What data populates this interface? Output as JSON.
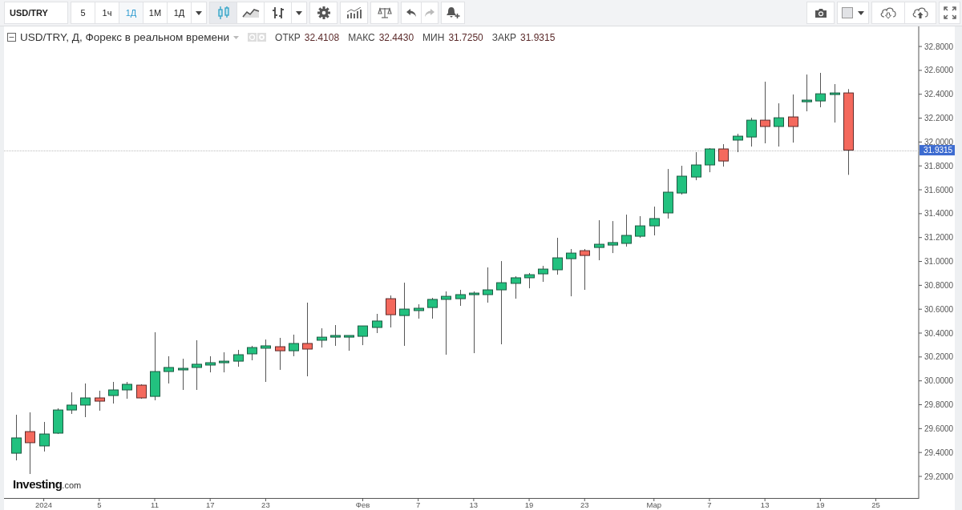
{
  "toolbar": {
    "symbol": "USD/TRY",
    "intervals": [
      {
        "label": "5",
        "selected": false
      },
      {
        "label": "1ч",
        "selected": false
      },
      {
        "label": "1Д",
        "selected": true
      },
      {
        "label": "1М",
        "selected": false
      },
      {
        "label": "1Д",
        "selected": false
      }
    ],
    "chart_styles": [
      {
        "kind": "candles",
        "selected": true
      },
      {
        "kind": "line",
        "selected": false
      },
      {
        "kind": "bars",
        "selected": false
      }
    ],
    "undo": {
      "disabled": false
    },
    "redo": {
      "disabled": true
    }
  },
  "legend": {
    "title": "USD/TRY, Д, Форекс в реальном времени",
    "stats": [
      {
        "label": "ОТКР",
        "value": "32.4108"
      },
      {
        "label": "МАКС",
        "value": "32.4430"
      },
      {
        "label": "МИН",
        "value": "31.7250"
      },
      {
        "label": "ЗАКР",
        "value": "31.9315"
      }
    ]
  },
  "chart": {
    "logo": {
      "brand": "Investing",
      "suffix": ".com"
    },
    "chart_data": {
      "type": "candlestick",
      "categories": [
        null,
        null,
        "2024",
        null,
        null,
        null,
        "5",
        null,
        null,
        null,
        "11",
        null,
        null,
        null,
        "17",
        null,
        null,
        null,
        "23",
        null,
        null,
        null,
        null,
        null,
        null,
        "Фев",
        null,
        null,
        null,
        "7",
        null,
        null,
        null,
        "13",
        null,
        null,
        null,
        "19",
        null,
        null,
        null,
        "23",
        null,
        null,
        null,
        null,
        "Мар",
        null,
        null,
        null,
        "7",
        null,
        null,
        null,
        "13",
        null,
        null,
        null,
        "19",
        null,
        null,
        null,
        "25"
      ],
      "ohlc": [
        [
          29.394,
          29.716,
          29.334,
          29.522
        ],
        [
          29.575,
          29.736,
          29.22,
          29.482
        ],
        [
          29.455,
          29.656,
          29.408,
          29.555
        ],
        [
          29.562,
          29.77,
          29.555,
          29.756
        ],
        [
          29.756,
          29.904,
          29.723,
          29.797
        ],
        [
          29.797,
          29.978,
          29.696,
          29.857
        ],
        [
          29.857,
          29.917,
          29.75,
          29.83
        ],
        [
          29.877,
          29.991,
          29.81,
          29.924
        ],
        [
          29.924,
          29.991,
          29.85,
          29.971
        ],
        [
          29.964,
          29.971,
          29.85,
          29.857
        ],
        [
          29.87,
          30.407,
          29.837,
          30.078
        ],
        [
          30.078,
          30.206,
          29.978,
          30.112
        ],
        [
          30.092,
          30.185,
          29.924,
          30.105
        ],
        [
          30.112,
          30.34,
          29.924,
          30.139
        ],
        [
          30.132,
          30.206,
          30.071,
          30.152
        ],
        [
          30.152,
          30.239,
          30.071,
          30.165
        ],
        [
          30.165,
          30.259,
          30.118,
          30.219
        ],
        [
          30.226,
          30.293,
          30.172,
          30.279
        ],
        [
          30.273,
          30.346,
          29.991,
          30.293
        ],
        [
          30.286,
          30.36,
          30.092,
          30.252
        ],
        [
          30.252,
          30.387,
          30.206,
          30.313
        ],
        [
          30.313,
          30.655,
          30.038,
          30.266
        ],
        [
          30.34,
          30.44,
          30.279,
          30.366
        ],
        [
          30.366,
          30.467,
          30.293,
          30.38
        ],
        [
          30.366,
          30.38,
          30.252,
          30.38
        ],
        [
          30.373,
          30.46,
          30.299,
          30.46
        ],
        [
          30.447,
          30.561,
          30.4,
          30.501
        ],
        [
          30.688,
          30.715,
          30.447,
          30.554
        ],
        [
          30.547,
          30.822,
          30.293,
          30.601
        ],
        [
          30.588,
          30.641,
          30.521,
          30.608
        ],
        [
          30.614,
          30.695,
          30.521,
          30.682
        ],
        [
          30.682,
          30.749,
          30.219,
          30.708
        ],
        [
          30.688,
          30.762,
          30.628,
          30.722
        ],
        [
          30.722,
          30.749,
          30.232,
          30.735
        ],
        [
          30.722,
          30.95,
          30.655,
          30.762
        ],
        [
          30.762,
          31.003,
          30.306,
          30.822
        ],
        [
          30.816,
          30.876,
          30.688,
          30.863
        ],
        [
          30.863,
          30.903,
          30.775,
          30.889
        ],
        [
          30.896,
          30.963,
          30.829,
          30.936
        ],
        [
          30.93,
          31.198,
          30.889,
          31.03
        ],
        [
          31.023,
          31.104,
          30.708,
          31.07
        ],
        [
          31.09,
          31.104,
          30.762,
          31.05
        ],
        [
          31.117,
          31.345,
          31.01,
          31.144
        ],
        [
          31.137,
          31.338,
          31.07,
          31.158
        ],
        [
          31.151,
          31.392,
          31.124,
          31.218
        ],
        [
          31.211,
          31.379,
          31.198,
          31.298
        ],
        [
          31.298,
          31.459,
          31.218,
          31.359
        ],
        [
          31.406,
          31.774,
          31.359,
          31.58
        ],
        [
          31.573,
          31.801,
          31.56,
          31.714
        ],
        [
          31.707,
          31.915,
          31.68,
          31.808
        ],
        [
          31.808,
          31.949,
          31.747,
          31.942
        ],
        [
          31.942,
          31.982,
          31.794,
          31.841
        ],
        [
          32.016,
          32.069,
          31.915,
          32.049
        ],
        [
          32.042,
          32.203,
          31.962,
          32.183
        ],
        [
          32.183,
          32.505,
          31.989,
          32.13
        ],
        [
          32.13,
          32.324,
          31.962,
          32.203
        ],
        [
          32.21,
          32.398,
          31.995,
          32.13
        ],
        [
          32.337,
          32.565,
          32.257,
          32.351
        ],
        [
          32.344,
          32.579,
          32.291,
          32.404
        ],
        [
          32.404,
          32.485,
          32.163,
          32.411
        ],
        [
          32.411,
          32.443,
          31.725,
          31.932
        ],
        null,
        null
      ],
      "ylim": [
        29.019,
        32.968
      ],
      "yticks": [
        {
          "value": 29.2,
          "label": "29.2000"
        },
        {
          "value": 29.4,
          "label": "29.4000"
        },
        {
          "value": 29.6,
          "label": "29.6000"
        },
        {
          "value": 29.8,
          "label": "29.8000"
        },
        {
          "value": 30.0,
          "label": "30.0000"
        },
        {
          "value": 30.2,
          "label": "30.2000"
        },
        {
          "value": 30.4,
          "label": "30.4000"
        },
        {
          "value": 30.6,
          "label": "30.6000"
        },
        {
          "value": 30.8,
          "label": "30.8000"
        },
        {
          "value": 31.0,
          "label": "31.0000"
        },
        {
          "value": 31.2,
          "label": "31.2000"
        },
        {
          "value": 31.4,
          "label": "31.4000"
        },
        {
          "value": 31.6,
          "label": "31.6000"
        },
        {
          "value": 31.8,
          "label": "31.8000"
        },
        {
          "value": 32.0,
          "label": "32.0000"
        },
        {
          "value": 32.2,
          "label": "32.2000"
        },
        {
          "value": 32.4,
          "label": "32.4000"
        },
        {
          "value": 32.6,
          "label": "32.6000"
        },
        {
          "value": 32.8,
          "label": "32.8000"
        }
      ],
      "ref_lines": [
        {
          "axis": "y",
          "value": 31.9315,
          "label": "31.9315"
        }
      ]
    }
  }
}
